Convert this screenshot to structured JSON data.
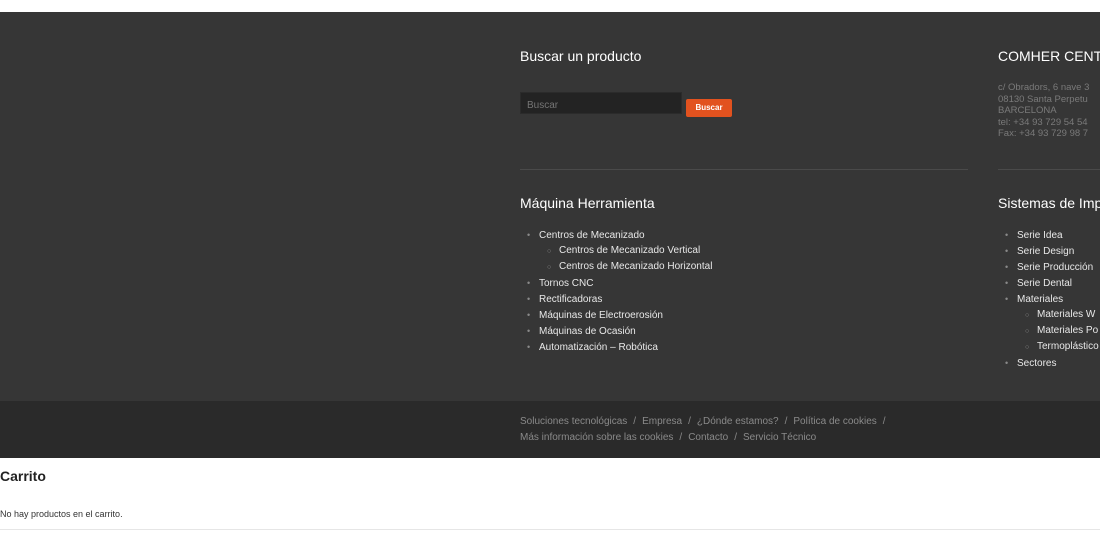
{
  "search": {
    "title": "Buscar un producto",
    "placeholder": "Buscar",
    "button_label": "Buscar"
  },
  "company": {
    "title": "COMHER CENT",
    "address_lines": [
      "c/ Obradors, 6 nave 3",
      "08130 Santa Perpetu",
      "BARCELONA",
      "tel: +34 93 729 54 54",
      "Fax: +34 93 729 98 7"
    ]
  },
  "maquina": {
    "title": "Máquina Herramienta",
    "items": [
      {
        "label": "Centros de Mecanizado",
        "level": 1
      },
      {
        "label": "Centros de Mecanizado Vertical",
        "level": 2
      },
      {
        "label": "Centros de Mecanizado Horizontal",
        "level": 2
      },
      {
        "label": "Tornos CNC",
        "level": 1
      },
      {
        "label": "Rectificadoras",
        "level": 1
      },
      {
        "label": "Máquinas de Electroerosión",
        "level": 1
      },
      {
        "label": "Máquinas de Ocasión",
        "level": 1
      },
      {
        "label": "Automatización – Robótica",
        "level": 1
      }
    ]
  },
  "sistemas": {
    "title": "Sistemas de Imp",
    "items": [
      {
        "label": "Serie Idea",
        "level": 1
      },
      {
        "label": "Serie Design",
        "level": 1
      },
      {
        "label": "Serie Producción",
        "level": 1
      },
      {
        "label": "Serie Dental",
        "level": 1
      },
      {
        "label": "Materiales",
        "level": 1
      },
      {
        "label": "Materiales W",
        "level": 2
      },
      {
        "label": "Materiales Po",
        "level": 2
      },
      {
        "label": "Termoplástico",
        "level": 2
      },
      {
        "label": "Sectores",
        "level": 1
      }
    ]
  },
  "bottom_nav": {
    "line1": [
      "Soluciones tecnológicas",
      "Empresa",
      "¿Dónde estamos?",
      "Política de cookies"
    ],
    "line2": [
      "Más información sobre las cookies",
      "Contacto",
      "Servicio Técnico"
    ],
    "separator": "/"
  },
  "cart": {
    "title": "Carrito",
    "empty_message": "No hay productos en el carrito."
  },
  "colors": {
    "footer_bg": "#363636",
    "bottom_bar_bg": "#2a2a2a",
    "accent": "#e2521f"
  }
}
